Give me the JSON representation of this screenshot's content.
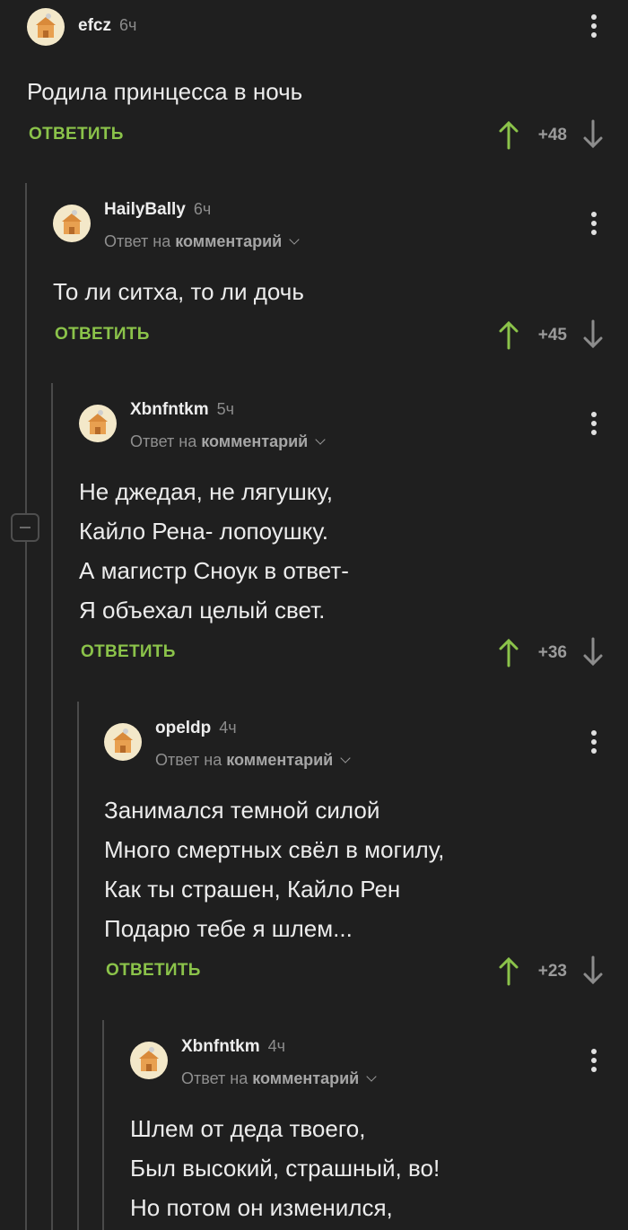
{
  "colors": {
    "background": "#1f1f1f",
    "accent_green": "#8bc34a",
    "muted_text": "#8f8f8f",
    "thread_line": "#4a4a4a"
  },
  "comments": [
    {
      "author": "efcz",
      "time": "6ч",
      "text_lines": [
        "Родила принцесса в ночь"
      ],
      "reply_label": "ОТВЕТИТЬ",
      "score": "+48",
      "icons": {
        "menu": "more-vertical-icon",
        "up": "arrow-up-icon",
        "down": "arrow-down-icon"
      }
    },
    {
      "author": "HailyBally",
      "time": "6ч",
      "reply_prefix": "Ответ на",
      "reply_target": "комментарий",
      "text_lines": [
        "То ли ситха, то ли дочь"
      ],
      "reply_label": "ОТВЕТИТЬ",
      "score": "+45"
    },
    {
      "author": "Xbnfntkm",
      "time": "5ч",
      "reply_prefix": "Ответ на",
      "reply_target": "комментарий",
      "text_lines": [
        "Не джедая, не лягушку,",
        "Кайло Рена- лопоушку.",
        "А магистр Сноук в ответ-",
        "Я объехал целый свет."
      ],
      "reply_label": "ОТВЕТИТЬ",
      "score": "+36"
    },
    {
      "author": "opeldp",
      "time": "4ч",
      "reply_prefix": "Ответ на",
      "reply_target": "комментарий",
      "text_lines": [
        "Занимался темной силой",
        "Много смертных свёл в могилу,",
        "Как ты страшен, Кайло Рен",
        "Подарю тебе я шлем..."
      ],
      "reply_label": "ОТВЕТИТЬ",
      "score": "+23"
    },
    {
      "author": "Xbnfntkm",
      "time": "4ч",
      "reply_prefix": "Ответ на",
      "reply_target": "комментарий",
      "text_lines": [
        "Шлем от деда твоего,",
        "Был высокий, страшный, во!",
        "Но потом он изменился,"
      ]
    }
  ]
}
